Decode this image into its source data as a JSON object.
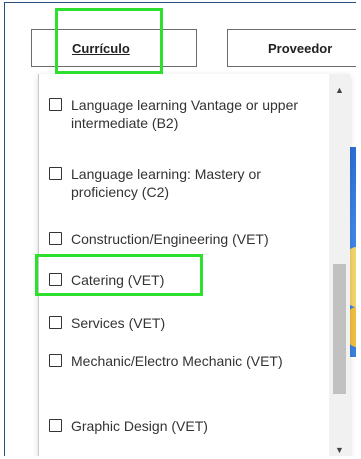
{
  "tabs": {
    "curriculo": "Currículo",
    "proveedor": "Proveedor"
  },
  "dropdown": {
    "cut_item": "Language learning Vantage or",
    "items": [
      {
        "label": "Language learning Vantage or upper intermediate (B2)",
        "checked": false
      },
      {
        "label": "Language learning: Mastery or proficiency (C2)",
        "checked": false
      },
      {
        "label": "Construction/Engineering (VET)",
        "checked": false
      },
      {
        "label": "Catering (VET)",
        "checked": false
      },
      {
        "label": "Services (VET)",
        "checked": false
      },
      {
        "label": "Mechanic/Electro Mechanic (VET)",
        "checked": false
      },
      {
        "label": "Graphic Design (VET)",
        "checked": false
      }
    ]
  },
  "scrollbar": {
    "up_icon": "▲",
    "down_icon": "▼"
  },
  "colors": {
    "highlight": "#2ee02e",
    "frame_border": "#2b4f7a"
  }
}
